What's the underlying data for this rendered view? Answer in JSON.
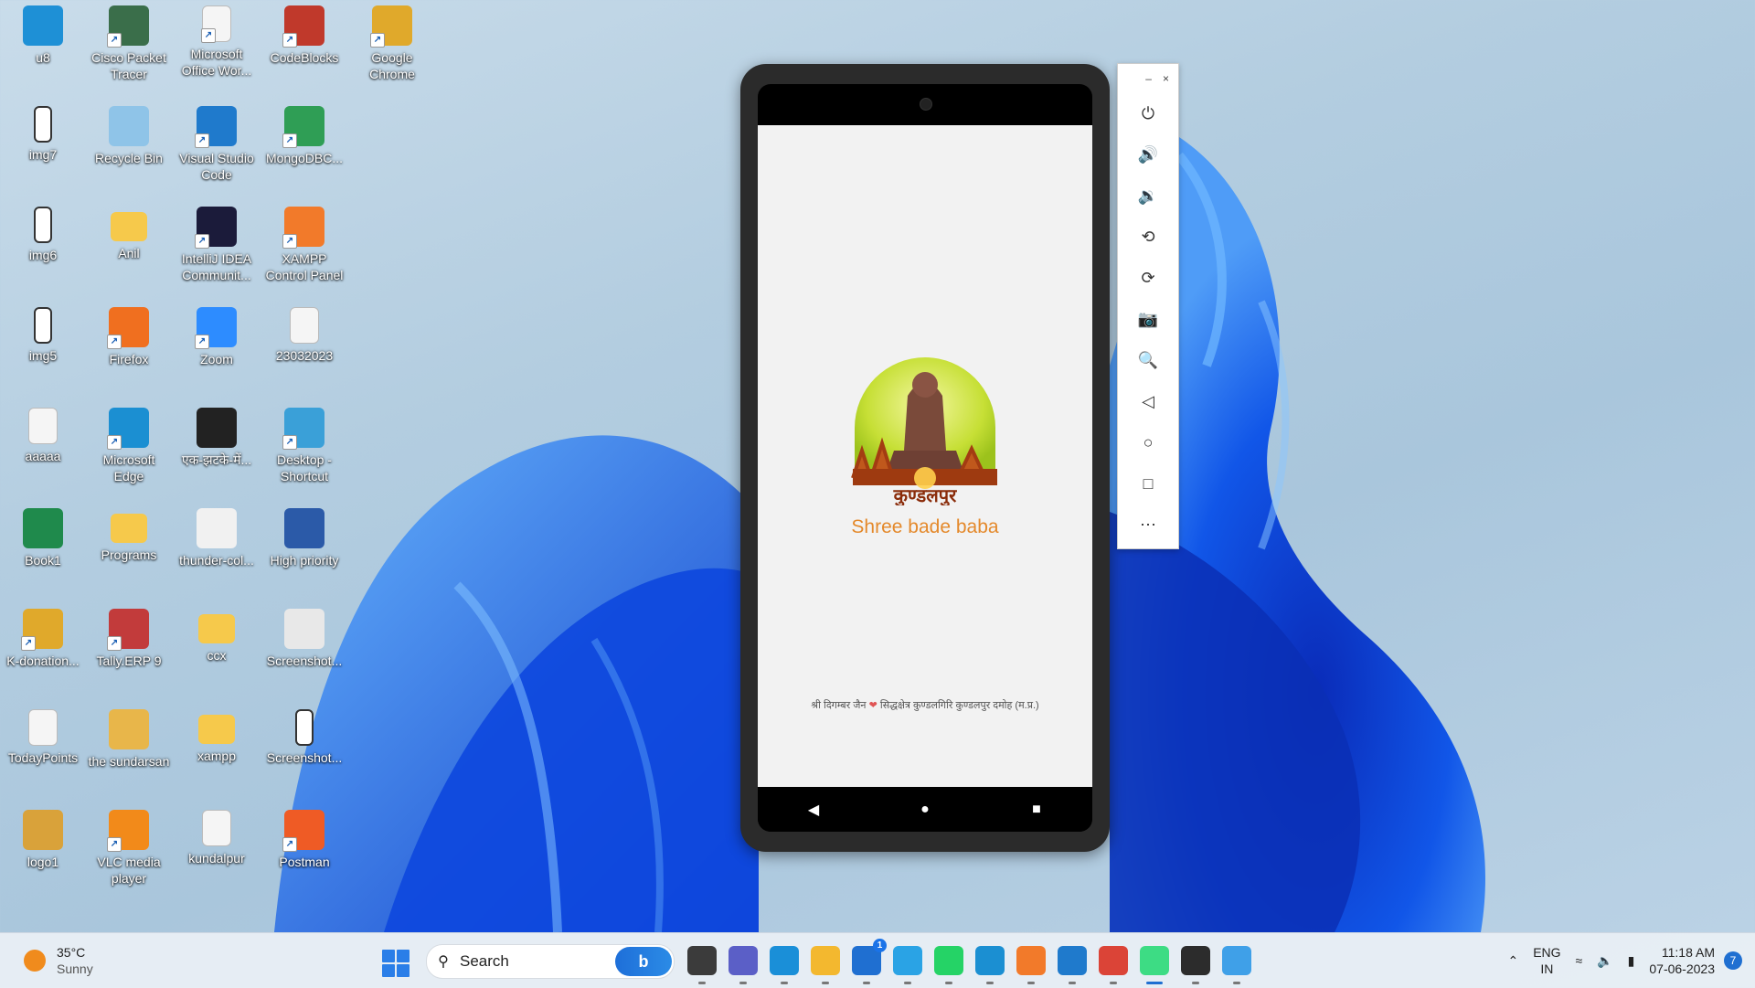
{
  "desktop": {
    "icons": [
      {
        "label": "u8",
        "icon": "monitor-icon",
        "col": 0,
        "row": 0
      },
      {
        "label": "Cisco Packet Tracer",
        "icon": "cisco-packet-tracer-icon",
        "col": 1,
        "row": 0
      },
      {
        "label": "Microsoft Office Wor...",
        "icon": "document-shortcut-icon",
        "col": 2,
        "row": 0
      },
      {
        "label": "CodeBlocks",
        "icon": "codeblocks-icon",
        "col": 3,
        "row": 0
      },
      {
        "label": "Google Chrome",
        "icon": "chrome-icon",
        "col": 4,
        "row": 0
      },
      {
        "label": "img7",
        "icon": "phone-image-icon",
        "col": 0,
        "row": 1
      },
      {
        "label": "Recycle Bin",
        "icon": "recycle-bin-icon",
        "col": 1,
        "row": 1
      },
      {
        "label": "Visual Studio Code",
        "icon": "vscode-icon",
        "col": 2,
        "row": 1
      },
      {
        "label": "MongoDBC...",
        "icon": "mongodb-compass-icon",
        "col": 3,
        "row": 1
      },
      {
        "label": "img6",
        "icon": "phone-image-icon",
        "col": 0,
        "row": 2
      },
      {
        "label": "Anil",
        "icon": "folder-icon",
        "col": 1,
        "row": 2
      },
      {
        "label": "IntelliJ IDEA Communit...",
        "icon": "intellij-icon",
        "col": 2,
        "row": 2
      },
      {
        "label": "XAMPP Control Panel",
        "icon": "xampp-icon",
        "col": 3,
        "row": 2
      },
      {
        "label": "img5",
        "icon": "phone-image-icon",
        "col": 0,
        "row": 3
      },
      {
        "label": "Firefox",
        "icon": "firefox-icon",
        "col": 1,
        "row": 3
      },
      {
        "label": "Zoom",
        "icon": "zoom-icon",
        "col": 2,
        "row": 3
      },
      {
        "label": "23032023",
        "icon": "document-icon",
        "col": 3,
        "row": 3
      },
      {
        "label": "aaaaa",
        "icon": "document-icon",
        "col": 0,
        "row": 4
      },
      {
        "label": "Microsoft Edge",
        "icon": "edge-icon",
        "col": 1,
        "row": 4
      },
      {
        "label": "एक-झटके-में...",
        "icon": "video-thumbnail-icon",
        "col": 2,
        "row": 4
      },
      {
        "label": "Desktop - Shortcut",
        "icon": "desktop-shortcut-icon",
        "col": 3,
        "row": 4
      },
      {
        "label": "Book1",
        "icon": "excel-icon",
        "col": 0,
        "row": 5
      },
      {
        "label": "Programs",
        "icon": "folder-icon",
        "col": 1,
        "row": 5
      },
      {
        "label": "thunder-col...",
        "icon": "json-file-icon",
        "col": 2,
        "row": 5
      },
      {
        "label": "High priority",
        "icon": "word-icon",
        "col": 3,
        "row": 5
      },
      {
        "label": "K-donation...",
        "icon": "chrome-icon",
        "col": 0,
        "row": 6
      },
      {
        "label": "Tally.ERP 9",
        "icon": "tally-icon",
        "col": 1,
        "row": 6
      },
      {
        "label": "ccx",
        "icon": "folder-icon",
        "col": 2,
        "row": 6
      },
      {
        "label": "Screenshot...",
        "icon": "screenshot-icon",
        "col": 3,
        "row": 6
      },
      {
        "label": "TodayPoints",
        "icon": "document-icon",
        "col": 0,
        "row": 7
      },
      {
        "label": "the sundarsan",
        "icon": "folder-image-icon",
        "col": 1,
        "row": 7
      },
      {
        "label": "xampp",
        "icon": "folder-icon",
        "col": 2,
        "row": 7
      },
      {
        "label": "Screenshot...",
        "icon": "phone-image-icon",
        "col": 3,
        "row": 7
      },
      {
        "label": "logo1",
        "icon": "logo-image-icon",
        "col": 0,
        "row": 8
      },
      {
        "label": "VLC media player",
        "icon": "vlc-icon",
        "col": 1,
        "row": 8
      },
      {
        "label": "kundalpur",
        "icon": "document-icon",
        "col": 2,
        "row": 8
      },
      {
        "label": "Postman",
        "icon": "postman-icon",
        "col": 3,
        "row": 8
      }
    ]
  },
  "emulator": {
    "app_title": "Shree bade baba",
    "logo_text": "कुण्डलपुर",
    "logo_arc_text": "श्री दिगम्बर जैन सिद्धक्षेत्र कुण्डलगिरि",
    "footer_left": "श्री दिगम्बर जैन",
    "footer_right": "सिद्धक्षेत्र कुण्डलगिरि कुण्डलपुर दमोह (म.प्र.)",
    "heart_color": "#e05555",
    "title_color": "#e4892b",
    "nav": [
      "back-icon",
      "home-icon",
      "recents-icon"
    ],
    "toolbar": {
      "minimize": "–",
      "close": "×",
      "buttons": [
        "power-icon",
        "volume-up-icon",
        "volume-down-icon",
        "rotate-left-icon",
        "rotate-right-icon",
        "camera-icon",
        "zoom-icon",
        "back-icon",
        "home-icon",
        "overview-icon",
        "more-icon"
      ]
    }
  },
  "taskbar": {
    "weather_temp": "35°C",
    "weather_desc": "Sunny",
    "search_placeholder": "Search",
    "apps": [
      {
        "name": "task-view-icon",
        "color": "#3b3b3b"
      },
      {
        "name": "teams-chat-icon",
        "color": "#5b5fc7"
      },
      {
        "name": "get-help-icon",
        "color": "#1a8fd8"
      },
      {
        "name": "file-explorer-icon",
        "color": "#f3b82f"
      },
      {
        "name": "microsoft-store-icon",
        "color": "#1f6fd1",
        "badge": "1"
      },
      {
        "name": "myjio-icon",
        "color": "#2aa3e5"
      },
      {
        "name": "whatsapp-icon",
        "color": "#25d366"
      },
      {
        "name": "edge-icon",
        "color": "#1b8fd2"
      },
      {
        "name": "xampp-icon",
        "color": "#f27a2a"
      },
      {
        "name": "vscode-icon",
        "color": "#1f7acc"
      },
      {
        "name": "chrome-icon",
        "color": "#db4437"
      },
      {
        "name": "android-studio-icon",
        "color": "#3ddc84",
        "active": true
      },
      {
        "name": "terminal-icon",
        "color": "#2c2c2c"
      },
      {
        "name": "paint-icon",
        "color": "#3fa0e8"
      }
    ],
    "lang_top": "ENG",
    "lang_bottom": "IN",
    "time": "11:18 AM",
    "date": "07-06-2023",
    "notification_count": "7"
  }
}
